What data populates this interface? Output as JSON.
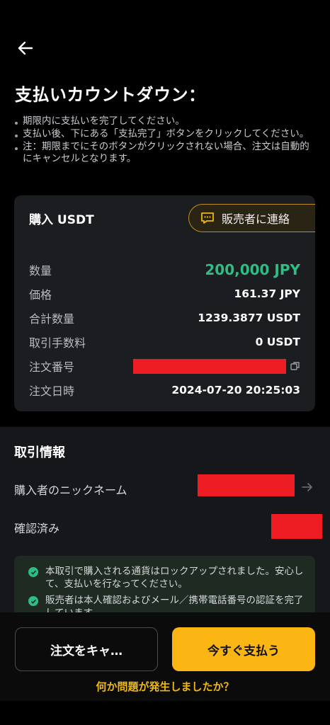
{
  "header": {
    "back_icon": "arrow-left-icon"
  },
  "title": "支払いカウントダウン：",
  "notes": [
    "期限内に支払いを完了してください。",
    "支払い後、下にある「支払完了」ボタンをクリックしてください。",
    "注：期限までにそのボタンがクリックされない場合、注文は自動的にキャンセルとなります。"
  ],
  "order": {
    "title": "購入 USDT",
    "contact_button": "販売者に連絡",
    "rows": [
      {
        "label": "数量",
        "value": "200,000 JPY"
      },
      {
        "label": "価格",
        "value": "161.37 JPY"
      },
      {
        "label": "合計数量",
        "value": "1239.3877 USDT"
      },
      {
        "label": "取引手数料",
        "value": "0 USDT"
      },
      {
        "label": "注文番号",
        "value": ""
      },
      {
        "label": "注文日時",
        "value": "2024-07-20 20:25:03"
      }
    ]
  },
  "trade_info": {
    "title": "取引情報",
    "buyer_nickname_label": "購入者のニックネーム",
    "verified_label": "確認済み",
    "checks": [
      "本取引で購入される通貨はロックアップされました。安心して、支払いを行なってください。",
      "販売者は本人確認およびメール／携帯電話番号の認証を完了しています。"
    ]
  },
  "actions": {
    "cancel_label": "注文をキャ…",
    "pay_label": "今すぐ支払う",
    "problem_link": "何か問題が発生しましたか？"
  },
  "colors": {
    "accent": "#fcb614",
    "green": "#2dbd85",
    "link": "#f0b90b"
  }
}
